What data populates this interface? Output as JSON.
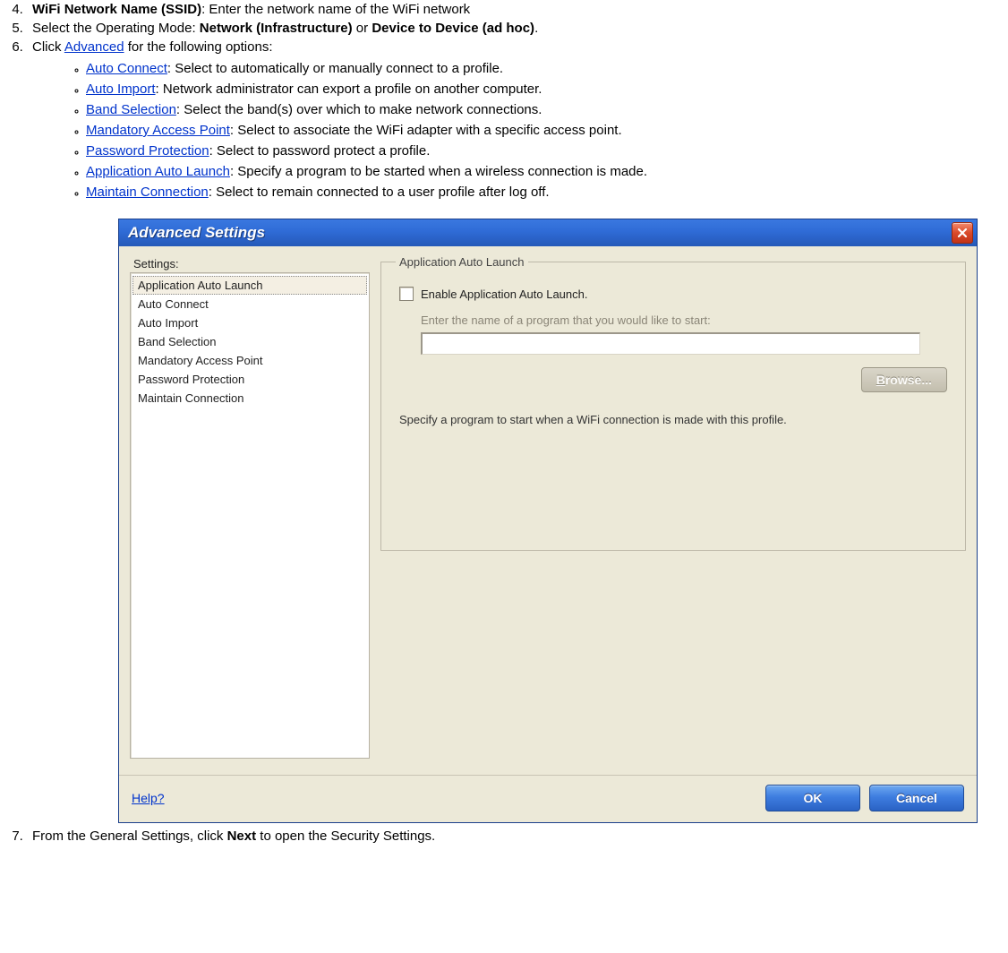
{
  "steps": {
    "s4": {
      "bold": "WiFi Network Name (SSID)",
      "text": ": Enter the network name of the WiFi network"
    },
    "s5": {
      "pre": "Select the Operating Mode: ",
      "b1": "Network (Infrastructure)",
      "mid": " or ",
      "b2": "Device to Device (ad hoc)",
      "post": "."
    },
    "s6": {
      "pre": "Click ",
      "link": "Advanced",
      "post": " for the following options:"
    },
    "s7": {
      "pre": "From the General Settings, click ",
      "bold": "Next",
      "post": " to open the Security Settings."
    }
  },
  "options": [
    {
      "link": "Auto Connect",
      "text": ": Select to automatically or manually connect to a profile."
    },
    {
      "link": "Auto Import",
      "text": ": Network administrator can export a profile on another computer."
    },
    {
      "link": "Band Selection",
      "text": ": Select the band(s) over which to make network connections."
    },
    {
      "link": "Mandatory Access Point",
      "text": ": Select to associate the WiFi adapter with a specific access point."
    },
    {
      "link": "Password Protection",
      "text": ": Select to password protect a profile."
    },
    {
      "link": "Application Auto Launch",
      "text": ": Specify a program to be started when a wireless connection is made."
    },
    {
      "link": "Maintain Connection",
      "text": ": Select to remain connected to a user profile after log off."
    }
  ],
  "dialog": {
    "title": "Advanced Settings",
    "settings_label": "Settings:",
    "settings_items": [
      "Application Auto Launch",
      "Auto Connect",
      "Auto Import",
      "Band Selection",
      "Mandatory Access Point",
      "Password Protection",
      "Maintain Connection"
    ],
    "group_legend": "Application Auto Launch",
    "checkbox_label": "Enable Application Auto Launch.",
    "hint": "Enter the name of a program that you would like to start:",
    "browse": "Browse...",
    "description": "Specify a program to start when a WiFi connection is made with this profile.",
    "help": "Help?",
    "ok": "OK",
    "cancel": "Cancel"
  }
}
